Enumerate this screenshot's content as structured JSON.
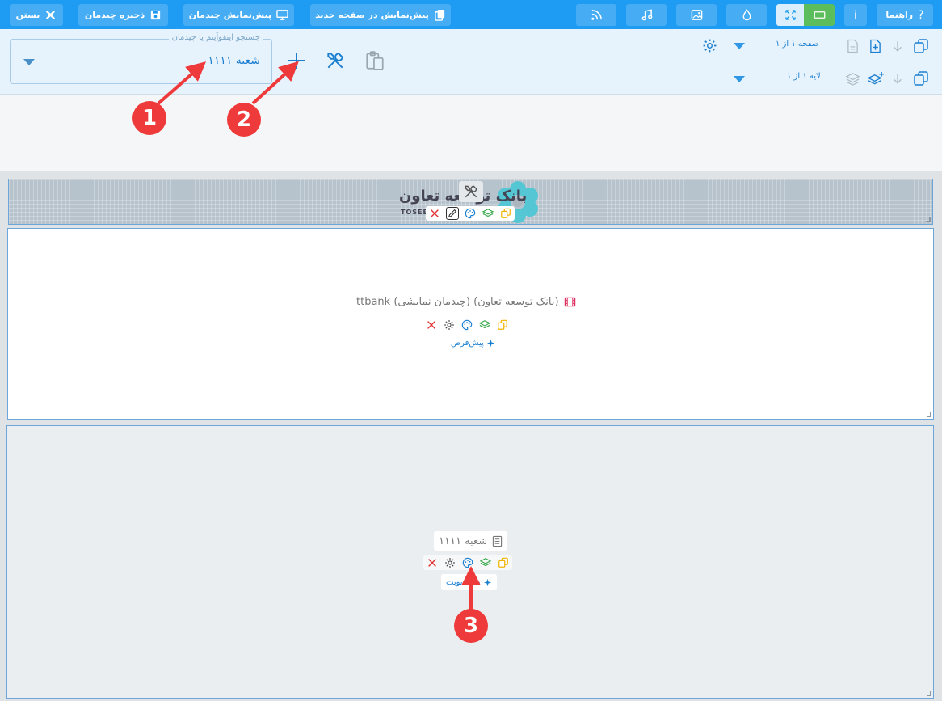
{
  "topbar": {
    "help": "راهنما",
    "info": "i",
    "preview_new_page": "پیش‌نمایش در صفحه جدید",
    "preview_layout": "پیش‌نمایش چیدمان",
    "save_layout": "ذخیره چیدمان",
    "close": "بستن"
  },
  "toolbar": {
    "page_label": "صفحه ۱ از ۱",
    "layer_label": "لایه ۱ از ۱",
    "search_legend": "جستجو اینفوآیتم یا چیدمان",
    "search_value": "شعبه ۱۱۱۱"
  },
  "header": {
    "logo_text": "بانک توسعه تعاون",
    "logo_sub": "TOSEE"
  },
  "content": {
    "item_label": "ttbank (چیدمان نمایشی) (بانک توسعه تعاون)",
    "preset_label": "پیش‌فرض"
  },
  "footer": {
    "item_label": "شعبه ۱۱۱۱",
    "preset_label": "صف نوبت"
  },
  "annotations": [
    "1",
    "2",
    "3"
  ],
  "colors": {
    "primary": "#1e9bf3",
    "annotation": "#ee3a3a",
    "accent_yellow": "#f0b400",
    "accent_green": "#3aa84a",
    "danger": "#e03030"
  }
}
